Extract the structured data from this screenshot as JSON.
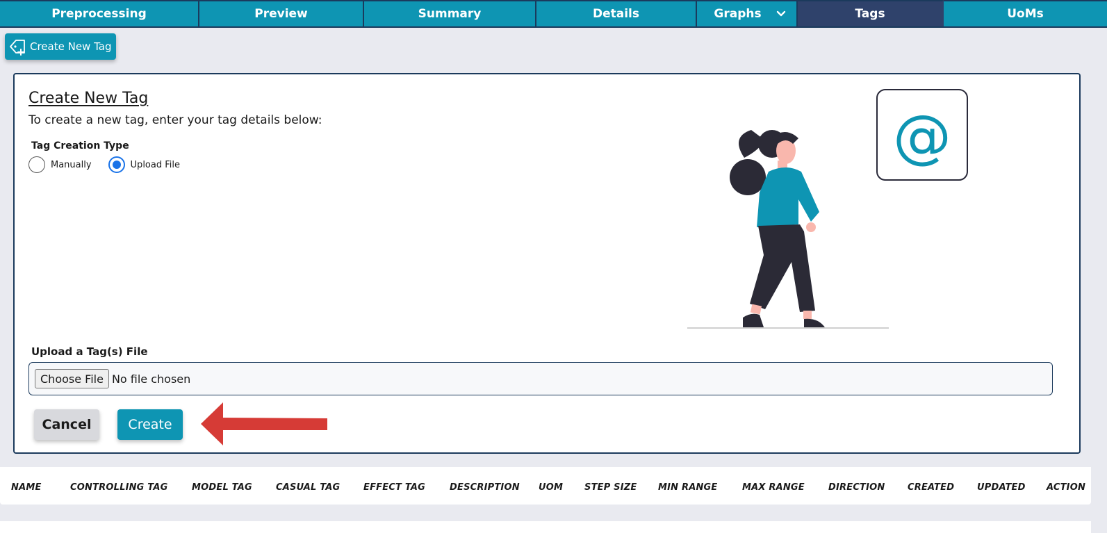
{
  "nav": {
    "tabs": [
      {
        "label": "Preprocessing"
      },
      {
        "label": "Preview"
      },
      {
        "label": "Summary"
      },
      {
        "label": "Details"
      },
      {
        "label": "Graphs"
      },
      {
        "label": "Tags"
      },
      {
        "label": "UoMs"
      }
    ],
    "active_tab": "Tags"
  },
  "create_button": {
    "label": "Create New Tag",
    "icon": "tag-plus-icon"
  },
  "form": {
    "title": "Create New Tag",
    "subtitle": "To create a new tag, enter your tag details below:",
    "type_label": "Tag Creation Type",
    "options": [
      {
        "label": "Manually",
        "checked": false
      },
      {
        "label": "Upload File",
        "checked": true
      }
    ],
    "upload_label": "Upload a Tag(s) File",
    "choose_file_label": "Choose File",
    "file_status": "No file chosen",
    "cancel_label": "Cancel",
    "create_label": "Create"
  },
  "table": {
    "columns": [
      "NAME",
      "CONTROLLING TAG",
      "MODEL TAG",
      "CASUAL TAG",
      "EFFECT TAG",
      "DESCRIPTION",
      "UOM",
      "STEP SIZE",
      "MIN RANGE",
      "MAX RANGE",
      "DIRECTION",
      "CREATED",
      "UPDATED",
      "ACTION"
    ]
  },
  "colors": {
    "primary": "#0e95b3",
    "active_tab": "#2f426b",
    "border": "#1b3a5c",
    "arrow": "#d63b36",
    "radio": "#1a73e8"
  }
}
